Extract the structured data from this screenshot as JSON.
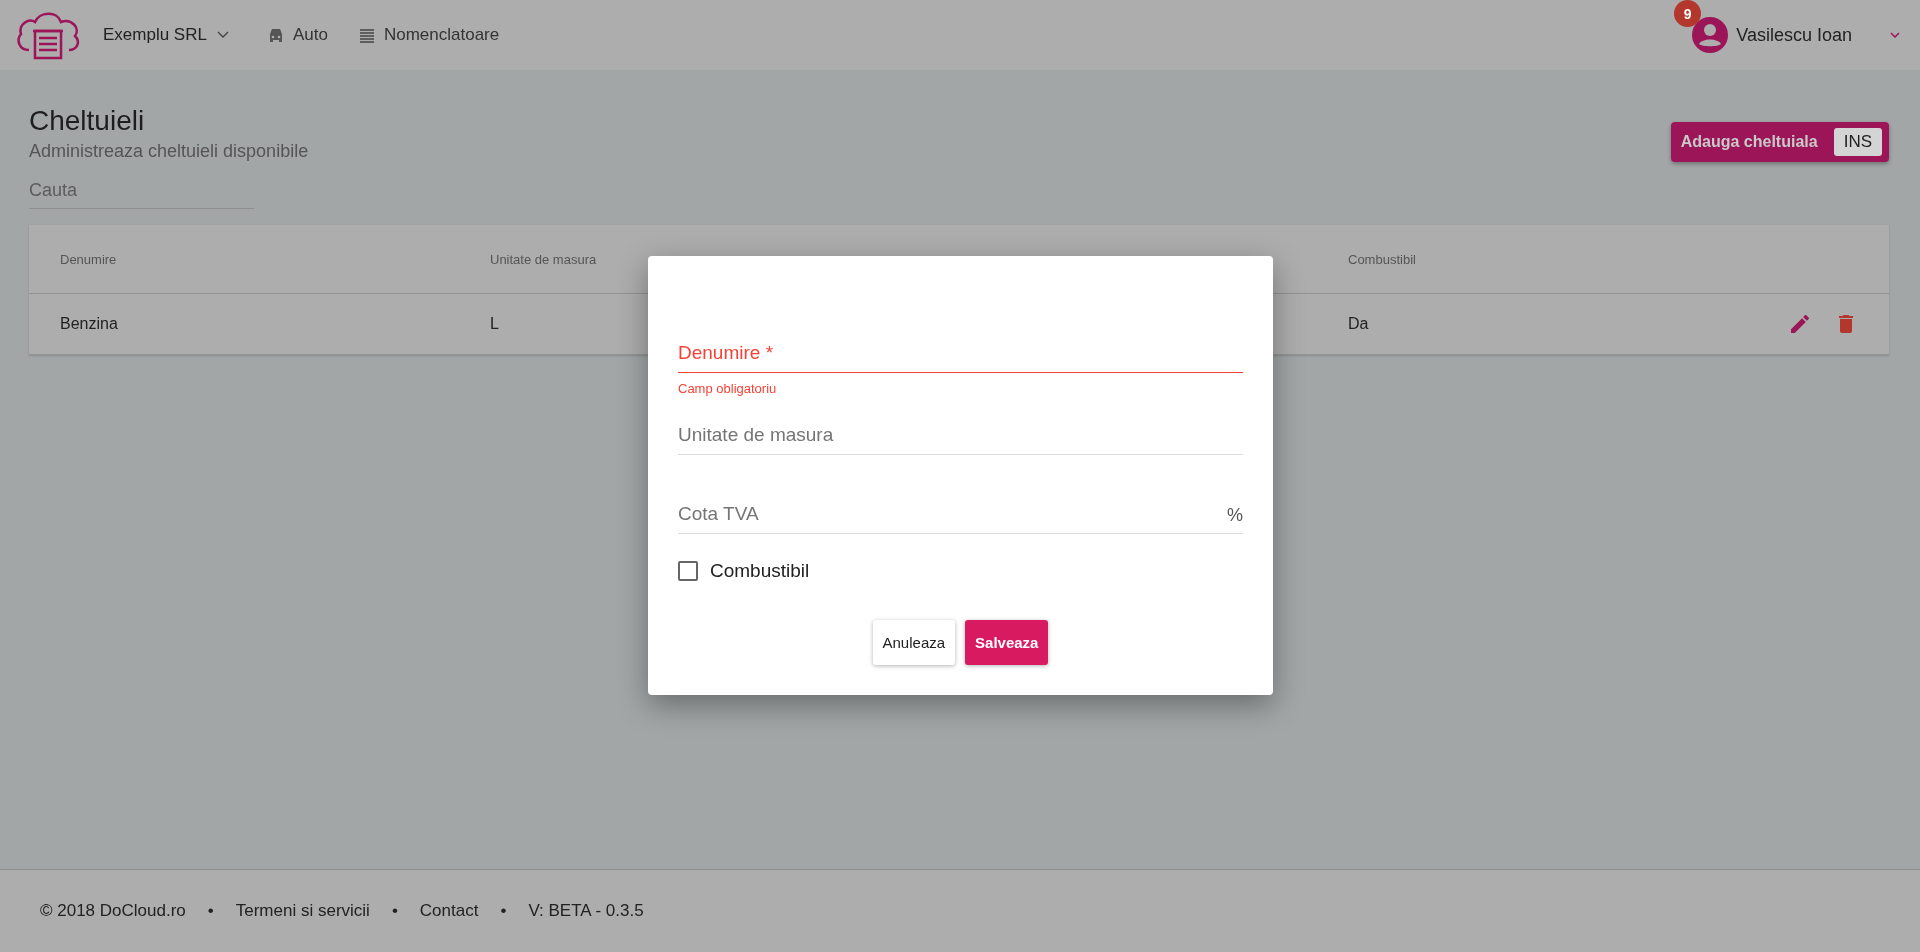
{
  "header": {
    "company": "Exemplu SRL",
    "nav": [
      {
        "label": "Auto",
        "kind": "car"
      },
      {
        "label": "Nomenclatoare",
        "kind": "list"
      }
    ],
    "notification_count": "9",
    "user": "Vasilescu Ioan"
  },
  "page": {
    "title": "Cheltuieli",
    "subtitle": "Administreaza cheltuieli disponibile",
    "add_button": "Adauga cheltuiala",
    "add_shortcut": "INS",
    "search": {
      "placeholder": "Cauta"
    }
  },
  "table": {
    "columns": [
      "Denumire",
      "Unitate de masura",
      "Combustibil"
    ],
    "rows": [
      {
        "cells": [
          "Benzina",
          "L",
          "Da"
        ]
      }
    ]
  },
  "dialog": {
    "fields": [
      {
        "placeholder": "Denumire *",
        "error": "Camp obligatoriu"
      },
      {
        "placeholder": "Unitate de masura"
      },
      {
        "placeholder": "Cota TVA",
        "suffix": "%"
      }
    ],
    "checkbox": {
      "label": "Combustibil",
      "checked": false
    },
    "buttons": [
      {
        "label": "Anuleaza",
        "kind": "secondary"
      },
      {
        "label": "Salveaza",
        "kind": "primary"
      }
    ]
  },
  "footer": {
    "items": [
      "© 2018 DoCloud.ro",
      "Termeni si servicii",
      "Contact",
      "V: BETA - 0.3.5"
    ],
    "separator": "•"
  }
}
